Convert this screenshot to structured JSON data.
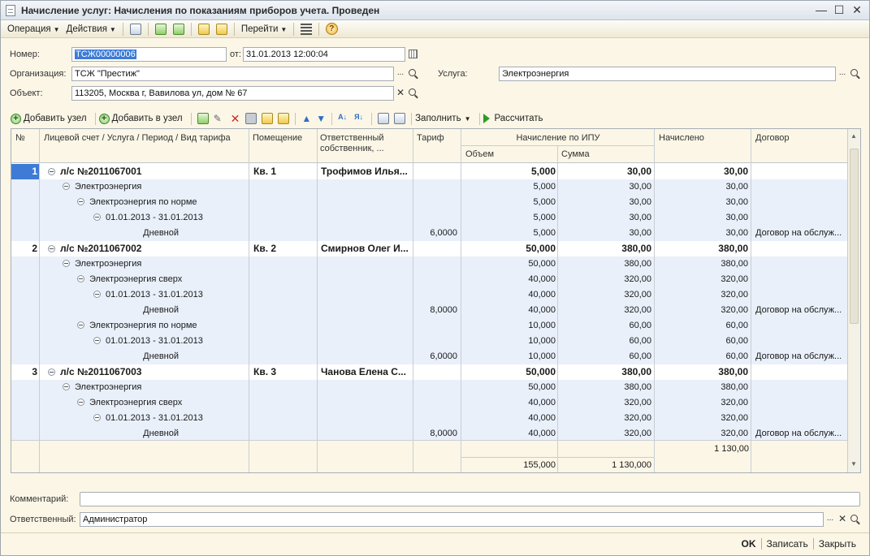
{
  "window": {
    "title": "Начисление услуг: Начисления по показаниям приборов учета. Проведен",
    "controls": {
      "minimize": "—",
      "maximize": "☐",
      "close": "✕"
    }
  },
  "toolbar": {
    "operation": "Операция",
    "actions": "Действия",
    "goto": "Перейти",
    "help": "?"
  },
  "form": {
    "number_label": "Номер:",
    "number_value": "ТСЖ00000006",
    "date_label": "от:",
    "date_value": "31.01.2013 12:00:04",
    "org_label": "Организация:",
    "org_value": "ТСЖ \"Престиж\"",
    "service_label": "Услуга:",
    "service_value": "Электроэнергия",
    "object_label": "Объект:",
    "object_value": "113205, Москва г, Вавилова ул, дом № 67",
    "comment_label": "Комментарий:",
    "comment_value": "",
    "responsible_label": "Ответственный:",
    "responsible_value": "Администратор"
  },
  "table_toolbar": {
    "add_node": "Добавить узел",
    "add_to_node": "Добавить в узел",
    "fill": "Заполнить",
    "calculate": "Рассчитать"
  },
  "grid": {
    "headers": {
      "num": "№",
      "account": "Лицевой счет / Услуга / Период / Вид тарифа",
      "room": "Помещение",
      "owner": "Ответственный собственник, ...",
      "tariff": "Тариф",
      "ipu": "Начисление по ИПУ",
      "volume": "Объем",
      "sum": "Сумма",
      "charged": "Начислено",
      "contract": "Договор"
    },
    "rows": [
      {
        "num": "1",
        "level": 0,
        "name": "л/с №2011067001",
        "room": "Кв. 1",
        "owner": "Трофимов Илья...",
        "tariff": "",
        "volume": "5,000",
        "sum": "30,00",
        "charged": "30,00",
        "contract": ""
      },
      {
        "num": "",
        "level": 1,
        "name": "Электроэнергия",
        "room": "",
        "owner": "",
        "tariff": "",
        "volume": "5,000",
        "sum": "30,00",
        "charged": "30,00",
        "contract": ""
      },
      {
        "num": "",
        "level": 2,
        "name": "Электроэнергия по норме",
        "room": "",
        "owner": "",
        "tariff": "",
        "volume": "5,000",
        "sum": "30,00",
        "charged": "30,00",
        "contract": ""
      },
      {
        "num": "",
        "level": 3,
        "name": "01.01.2013 - 31.01.2013",
        "room": "",
        "owner": "",
        "tariff": "",
        "volume": "5,000",
        "sum": "30,00",
        "charged": "30,00",
        "contract": ""
      },
      {
        "num": "",
        "level": 4,
        "name": "Дневной",
        "room": "",
        "owner": "",
        "tariff": "6,0000",
        "volume": "5,000",
        "sum": "30,00",
        "charged": "30,00",
        "contract": "Договор на обслуж..."
      },
      {
        "num": "2",
        "level": 0,
        "name": "л/с №2011067002",
        "room": "Кв. 2",
        "owner": "Смирнов Олег И...",
        "tariff": "",
        "volume": "50,000",
        "sum": "380,00",
        "charged": "380,00",
        "contract": ""
      },
      {
        "num": "",
        "level": 1,
        "name": "Электроэнергия",
        "room": "",
        "owner": "",
        "tariff": "",
        "volume": "50,000",
        "sum": "380,00",
        "charged": "380,00",
        "contract": ""
      },
      {
        "num": "",
        "level": 2,
        "name": "Электроэнергия сверх",
        "room": "",
        "owner": "",
        "tariff": "",
        "volume": "40,000",
        "sum": "320,00",
        "charged": "320,00",
        "contract": ""
      },
      {
        "num": "",
        "level": 3,
        "name": "01.01.2013 - 31.01.2013",
        "room": "",
        "owner": "",
        "tariff": "",
        "volume": "40,000",
        "sum": "320,00",
        "charged": "320,00",
        "contract": ""
      },
      {
        "num": "",
        "level": 4,
        "name": "Дневной",
        "room": "",
        "owner": "",
        "tariff": "8,0000",
        "volume": "40,000",
        "sum": "320,00",
        "charged": "320,00",
        "contract": "Договор на обслуж..."
      },
      {
        "num": "",
        "level": 2,
        "name": "Электроэнергия по норме",
        "room": "",
        "owner": "",
        "tariff": "",
        "volume": "10,000",
        "sum": "60,00",
        "charged": "60,00",
        "contract": ""
      },
      {
        "num": "",
        "level": 3,
        "name": "01.01.2013 - 31.01.2013",
        "room": "",
        "owner": "",
        "tariff": "",
        "volume": "10,000",
        "sum": "60,00",
        "charged": "60,00",
        "contract": ""
      },
      {
        "num": "",
        "level": 4,
        "name": "Дневной",
        "room": "",
        "owner": "",
        "tariff": "6,0000",
        "volume": "10,000",
        "sum": "60,00",
        "charged": "60,00",
        "contract": "Договор на обслуж..."
      },
      {
        "num": "3",
        "level": 0,
        "name": "л/с №2011067003",
        "room": "Кв. 3",
        "owner": "Чанова Елена С...",
        "tariff": "",
        "volume": "50,000",
        "sum": "380,00",
        "charged": "380,00",
        "contract": ""
      },
      {
        "num": "",
        "level": 1,
        "name": "Электроэнергия",
        "room": "",
        "owner": "",
        "tariff": "",
        "volume": "50,000",
        "sum": "380,00",
        "charged": "380,00",
        "contract": ""
      },
      {
        "num": "",
        "level": 2,
        "name": "Электроэнергия сверх",
        "room": "",
        "owner": "",
        "tariff": "",
        "volume": "40,000",
        "sum": "320,00",
        "charged": "320,00",
        "contract": ""
      },
      {
        "num": "",
        "level": 3,
        "name": "01.01.2013 - 31.01.2013",
        "room": "",
        "owner": "",
        "tariff": "",
        "volume": "40,000",
        "sum": "320,00",
        "charged": "320,00",
        "contract": ""
      },
      {
        "num": "",
        "level": 4,
        "name": "Дневной",
        "room": "",
        "owner": "",
        "tariff": "8,0000",
        "volume": "40,000",
        "sum": "320,00",
        "charged": "320,00",
        "contract": "Договор на обслуж..."
      }
    ],
    "totals": {
      "charged": "1 130,00",
      "volume": "155,000",
      "sum": "1 130,000"
    }
  },
  "footer": {
    "ok": "OK",
    "save": "Записать",
    "close": "Закрыть"
  }
}
